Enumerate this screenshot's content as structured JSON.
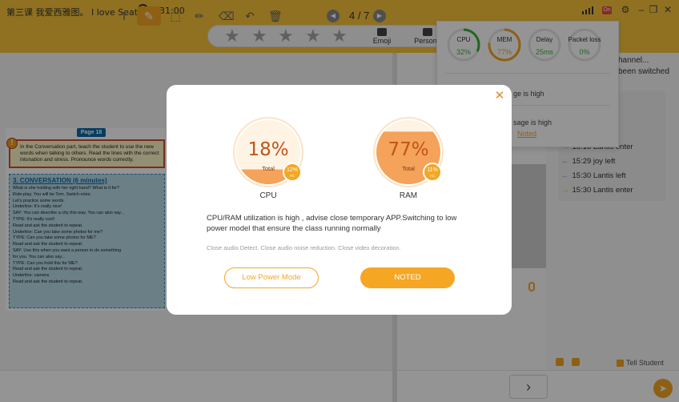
{
  "titlebar": {
    "title": "第三课 我爱西雅图。 I love Seattle.",
    "timer": "931:00",
    "net_badge": "On"
  },
  "toolbar": {
    "stars": [
      "★",
      "★",
      "★",
      "★",
      "★"
    ],
    "emoji_label": "Emoji",
    "personal_label": "Persona"
  },
  "lesson": {
    "page_tag": "Page 18",
    "warning": "In the Conversation part, teach the student to use the new words when talking to others. Read the lines with the correct intonation and stress. Pronounce words correctly.",
    "conversation_title": "3. CONVERSATION (6 minutes)",
    "lines": [
      "What is she holding with her right hand? What is it for?",
      "Role-play. You will be Tom. Switch roles.",
      "Let's practice some words.",
      "Underline: It's really nice!",
      "SAY: You can describe a city this way. You can also say...",
      "TYPE: It's really cool!",
      "Read and ask the student to repeat.",
      "Underline: Can you take some photos for me?",
      "TYPE: Can you take some photos for ME?",
      "Read and ask the student to repeat.",
      "SAY: Use this when you want a person to do something",
      "for you. You can also say...",
      "TYPE: Can you hold this for ME?",
      "Read and ask the student to repeat.",
      "Underline: camera",
      "Read and ask the student to repeat."
    ]
  },
  "bottombar": {
    "tools": [
      "T",
      "✎",
      "⬚",
      "✏",
      "⌫",
      "↶",
      "🗑"
    ],
    "prev": "◀",
    "next": "▶",
    "page": "4 / 7"
  },
  "chat": {
    "line1": "hannel...",
    "line2": "been switched",
    "logs": [
      "15:18 Lantis enter",
      "15:29 joy left",
      "15:30 Lantis left",
      "15:30 Lantis enter"
    ],
    "tell_student": "Tell Student",
    "next_arrow": "›",
    "send_icon": "➤"
  },
  "stats": {
    "items": [
      {
        "label": "CPU",
        "value": "32%",
        "percent": 32,
        "color": "#3cae3c"
      },
      {
        "label": "MEM",
        "value": "77%",
        "percent": 77,
        "color": "#f5a623"
      },
      {
        "label": "Delay",
        "value": "25ms",
        "percent": 0,
        "color": "#3cae3c"
      },
      {
        "label": "Packet loss",
        "value": "0%",
        "percent": 0,
        "color": "#3cae3c"
      }
    ],
    "text1": "ge is high",
    "text2": "sage is high",
    "noted_link": "Noted"
  },
  "modal": {
    "close": "✕",
    "cpu": {
      "percent_text": "18%",
      "total_label": "Total",
      "ac_value": "12%",
      "ac_label": "AC",
      "label": "CPU",
      "level": 0.18
    },
    "ram": {
      "percent_text": "77%",
      "total_label": "Total",
      "ac_value": "11%",
      "ac_label": "AC",
      "label": "RAM",
      "level": 0.77
    },
    "message": "CPU/RAM utilization is high , advise close temporary APP.Switching to low power model that ensure the class running normally",
    "hint": "Close audio Detect. Close audio noise reduction. Close video decoration.",
    "low_power_label": "Low Power Mode",
    "noted_label": "NOTED"
  },
  "colors": {
    "accent": "#f5a623",
    "titlebar": "#f7c33a"
  }
}
